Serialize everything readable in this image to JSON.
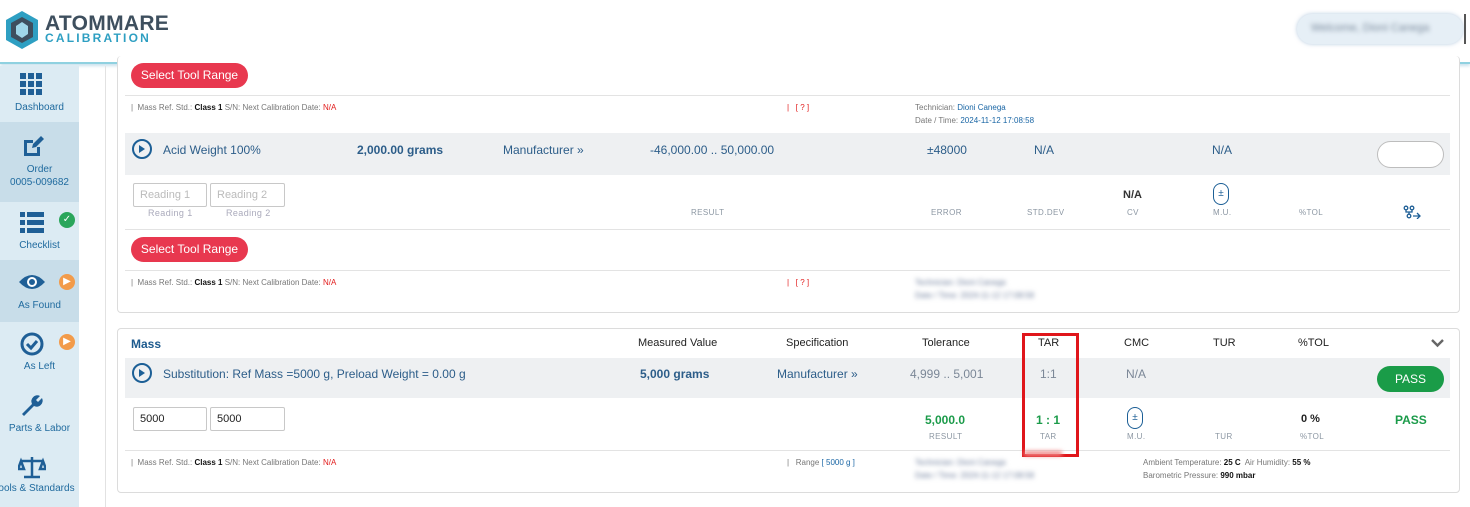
{
  "brand": {
    "name": "ATOMMARE",
    "sub": "CALIBRATION",
    "welcome": "Welcome, Dioni Canega"
  },
  "sidebar": {
    "items": [
      {
        "label": "Dashboard"
      },
      {
        "label": "Order",
        "sub": "0005-009682"
      },
      {
        "label": "Checklist",
        "badge": "✓"
      },
      {
        "label": "As Found",
        "badge": "▶"
      },
      {
        "label": "As Left",
        "badge": "▶"
      },
      {
        "label": "Parts & Labor"
      },
      {
        "label": "ools & Standards"
      }
    ]
  },
  "card1": {
    "select_label": "Select Tool Range",
    "info1": {
      "prefix": "Mass Ref. Std.: ",
      "cls": "Class 1",
      "mid": " S/N:  Next Calibration Date: ",
      "na": "N/A",
      "q": "[ ? ]",
      "tech_label": "Technician: ",
      "tech": "Dioni Canega",
      "dt_label": "Date / Time: ",
      "dt": "2024-11-12 17:08:58"
    },
    "row": {
      "name": "Acid Weight 100%",
      "value": "2,000.00  grams",
      "spec": "Manufacturer »",
      "range": "-46,000.00 .. 50,000.00",
      "tol": "±48000",
      "na1": "N/A",
      "na2": "N/A"
    },
    "readings": {
      "ph1": "Reading 1",
      "ph2": "Reading 2",
      "result": "RESULT",
      "error": "ERROR",
      "stddev": "STD.DEV",
      "cv_val": "N/A",
      "cv": "CV",
      "mu": "M.U.",
      "tol": "%TOL",
      "pm": "±"
    },
    "select_label2": "Select Tool Range",
    "info2": {
      "prefix": "Mass Ref. Std.: ",
      "cls": "Class 1",
      "mid": " S/N:  Next Calibration Date: ",
      "na": "N/A",
      "q": "[ ? ]",
      "blur1": "Technician: Dioni Canega",
      "blur2": "Date / Time: 2024-11-12 17:08:58"
    }
  },
  "card2": {
    "headers": {
      "title": "Mass",
      "measured": "Measured Value",
      "spec": "Specification",
      "tol": "Tolerance",
      "tar": "TAR",
      "cmc": "CMC",
      "tur": "TUR",
      "ptol": "%TOL"
    },
    "row": {
      "name": "Substitution: Ref Mass =5000 g, Preload Weight = 0.00 g",
      "value": "5,000  grams",
      "spec": "Manufacturer »",
      "range": "4,999 .. 5,001",
      "tar": "1:1",
      "cmc": "N/A",
      "pass": "PASS"
    },
    "readings": {
      "in1": "5000",
      "in2": "5000",
      "result_val": "5,000.0",
      "result": "RESULT",
      "tar_val": "1 : 1",
      "tar": "TAR",
      "mu": "M.U.",
      "tur": "TUR",
      "ptol_val": "0 %",
      "ptol": "%TOL",
      "pass": "PASS",
      "pm": "±"
    },
    "info": {
      "prefix": "Mass Ref. Std.: ",
      "cls": "Class 1",
      "mid": " S/N:  Next Calibration Date: ",
      "na": "N/A",
      "range_label": "Range ",
      "range": "[ 5000 g ]",
      "blur1": "Technician: Dioni Canega",
      "blur2": "Date / Time: 2024-11-12 17:08:58",
      "amb_label": "Ambient Temperature: ",
      "amb": "25 C",
      "hum_label": "Air Humidity: ",
      "hum": "55 %",
      "baro_label": "Barometric Pressure: ",
      "baro": "990 mbar"
    }
  }
}
